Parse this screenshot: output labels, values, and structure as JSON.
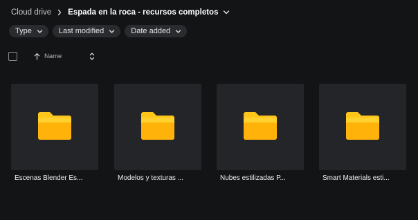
{
  "breadcrumb": {
    "root": "Cloud drive",
    "current": "Espada en la roca - recursos completos"
  },
  "filters": [
    {
      "label": "Type"
    },
    {
      "label": "Last modified"
    },
    {
      "label": "Date added"
    }
  ],
  "list_header": {
    "sort_label": "Name"
  },
  "folders": [
    {
      "name": "Escenas Blender Es..."
    },
    {
      "name": "Modelos y texturas ..."
    },
    {
      "name": "Nubes estilizadas P..."
    },
    {
      "name": "Smart Materials esti..."
    }
  ],
  "colors": {
    "background": "#131416",
    "card": "#242529",
    "chip": "#2a2b2e",
    "folder_light": "#ffd02e",
    "folder_dark": "#f5a300"
  }
}
